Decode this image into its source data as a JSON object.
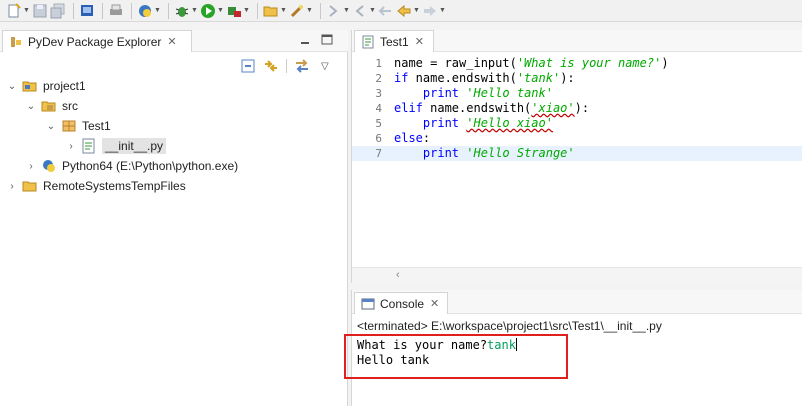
{
  "toolbar": {
    "icons": [
      "new-icon",
      "save-icon",
      "save-all-icon",
      "open-type-icon",
      "print-icon",
      "python-icon",
      "debug-icon",
      "run-icon",
      "external-tools-icon",
      "open-folder-icon",
      "search-icon",
      "next-annotation-icon",
      "prev-annotation-icon",
      "back-icon",
      "forward-icon"
    ]
  },
  "explorer": {
    "tab_label": "PyDev Package Explorer",
    "tree": [
      {
        "label": "project1",
        "level": 0,
        "expanded": true,
        "icon": "project-folder-icon"
      },
      {
        "label": "src",
        "level": 1,
        "expanded": true,
        "icon": "source-folder-icon"
      },
      {
        "label": "Test1",
        "level": 2,
        "expanded": true,
        "icon": "package-icon"
      },
      {
        "label": "__init__.py",
        "level": 3,
        "expanded": false,
        "icon": "python-file-icon",
        "selected": true
      },
      {
        "label": "Python64  (E:\\Python\\python.exe)",
        "level": 1,
        "expanded": false,
        "icon": "python-interpreter-icon"
      },
      {
        "label": "RemoteSystemsTempFiles",
        "level": 0,
        "expanded": false,
        "icon": "folder-icon"
      }
    ]
  },
  "editor": {
    "tab_label": "Test1",
    "lines": [
      {
        "n": "1",
        "parts": [
          {
            "t": "name = raw_input(",
            "c": ""
          },
          {
            "t": "'What is your name?'",
            "c": "str"
          },
          {
            "t": ")",
            "c": ""
          }
        ]
      },
      {
        "n": "2",
        "parts": [
          {
            "t": "if",
            "c": "kw"
          },
          {
            "t": " name.endswith(",
            "c": ""
          },
          {
            "t": "'tank'",
            "c": "str"
          },
          {
            "t": "):",
            "c": ""
          }
        ]
      },
      {
        "n": "3",
        "parts": [
          {
            "t": "    ",
            "c": ""
          },
          {
            "t": "print",
            "c": "kw"
          },
          {
            "t": " ",
            "c": ""
          },
          {
            "t": "'Hello tank'",
            "c": "str"
          }
        ]
      },
      {
        "n": "4",
        "parts": [
          {
            "t": "elif",
            "c": "kw"
          },
          {
            "t": " name.endswith(",
            "c": ""
          },
          {
            "t": "'xiao'",
            "c": "str squig"
          },
          {
            "t": "):",
            "c": ""
          }
        ]
      },
      {
        "n": "5",
        "parts": [
          {
            "t": "    ",
            "c": ""
          },
          {
            "t": "print",
            "c": "kw"
          },
          {
            "t": " ",
            "c": ""
          },
          {
            "t": "'Hello xiao'",
            "c": "str squig"
          }
        ]
      },
      {
        "n": "6",
        "parts": [
          {
            "t": "else",
            "c": "kw"
          },
          {
            "t": ":",
            "c": ""
          }
        ]
      },
      {
        "n": "7",
        "parts": [
          {
            "t": "    ",
            "c": ""
          },
          {
            "t": "print",
            "c": "kw"
          },
          {
            "t": " ",
            "c": ""
          },
          {
            "t": "'Hello Strange'",
            "c": "str"
          }
        ],
        "current": true
      }
    ]
  },
  "console": {
    "tab_label": "Console",
    "status": "<terminated> E:\\workspace\\project1\\src\\Test1\\__init__.py",
    "prompt": "What is your name?",
    "input": "tank",
    "output": "Hello tank"
  },
  "colors": {
    "keyword": "#0000ff",
    "string": "#00aa00",
    "highlight_box": "#e0201d",
    "console_input": "#00a05a"
  }
}
